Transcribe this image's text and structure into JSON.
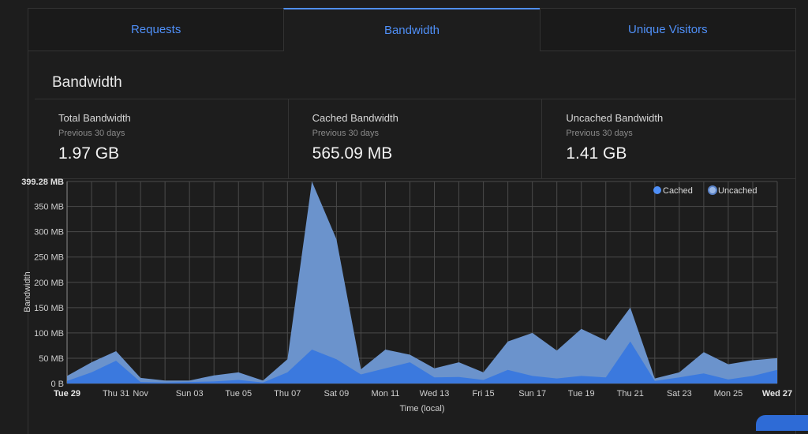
{
  "tabs": [
    {
      "label": "Requests",
      "active": false
    },
    {
      "label": "Bandwidth",
      "active": true
    },
    {
      "label": "Unique Visitors",
      "active": false
    }
  ],
  "section_title": "Bandwidth",
  "stats": [
    {
      "label": "Total Bandwidth",
      "sub": "Previous 30 days",
      "value": "1.97 GB"
    },
    {
      "label": "Cached Bandwidth",
      "sub": "Previous 30 days",
      "value": "565.09 MB"
    },
    {
      "label": "Uncached Bandwidth",
      "sub": "Previous 30 days",
      "value": "1.41 GB"
    }
  ],
  "colors": {
    "accent": "#4f8ff7",
    "cached": "#3b79de",
    "uncached": "#6b93cc"
  },
  "chart_data": {
    "type": "area",
    "xlabel": "Time (local)",
    "ylabel": "Bandwidth",
    "ylim": [
      0,
      399.28
    ],
    "y_ticks": [
      {
        "value": 0,
        "label": "0 B"
      },
      {
        "value": 50,
        "label": "50 MB"
      },
      {
        "value": 100,
        "label": "100 MB"
      },
      {
        "value": 150,
        "label": "150 MB"
      },
      {
        "value": 200,
        "label": "200 MB"
      },
      {
        "value": 250,
        "label": "250 MB"
      },
      {
        "value": 300,
        "label": "300 MB"
      },
      {
        "value": 350,
        "label": "350 MB"
      },
      {
        "value": 399.28,
        "label": "399.28 MB",
        "bold": true
      }
    ],
    "x_ticks": [
      {
        "index": 0,
        "label": "Tue 29",
        "bold": true
      },
      {
        "index": 2,
        "label": "Thu 31"
      },
      {
        "index": 3,
        "label": "Nov"
      },
      {
        "index": 5,
        "label": "Sun 03"
      },
      {
        "index": 7,
        "label": "Tue 05"
      },
      {
        "index": 9,
        "label": "Thu 07"
      },
      {
        "index": 11,
        "label": "Sat 09"
      },
      {
        "index": 13,
        "label": "Mon 11"
      },
      {
        "index": 15,
        "label": "Wed 13"
      },
      {
        "index": 17,
        "label": "Fri 15"
      },
      {
        "index": 19,
        "label": "Sun 17"
      },
      {
        "index": 21,
        "label": "Tue 19"
      },
      {
        "index": 23,
        "label": "Thu 21"
      },
      {
        "index": 25,
        "label": "Sat 23"
      },
      {
        "index": 27,
        "label": "Mon 25"
      },
      {
        "index": 29,
        "label": "Wed 27",
        "bold": true
      }
    ],
    "series": [
      {
        "name": "Cached",
        "values": [
          5,
          22,
          45,
          3,
          2,
          3,
          4,
          7,
          2,
          22,
          67,
          48,
          18,
          30,
          42,
          12,
          13,
          7,
          27,
          15,
          10,
          15,
          12,
          83,
          5,
          12,
          20,
          8,
          15,
          27
        ]
      },
      {
        "name": "Uncached",
        "values": [
          15,
          42,
          64,
          11,
          6,
          6,
          16,
          22,
          6,
          48,
          399.28,
          285,
          28,
          67,
          57,
          30,
          42,
          22,
          83,
          100,
          65,
          108,
          85,
          150,
          10,
          22,
          62,
          38,
          46,
          50
        ]
      }
    ],
    "legend_position": "top-right",
    "grid": true
  }
}
